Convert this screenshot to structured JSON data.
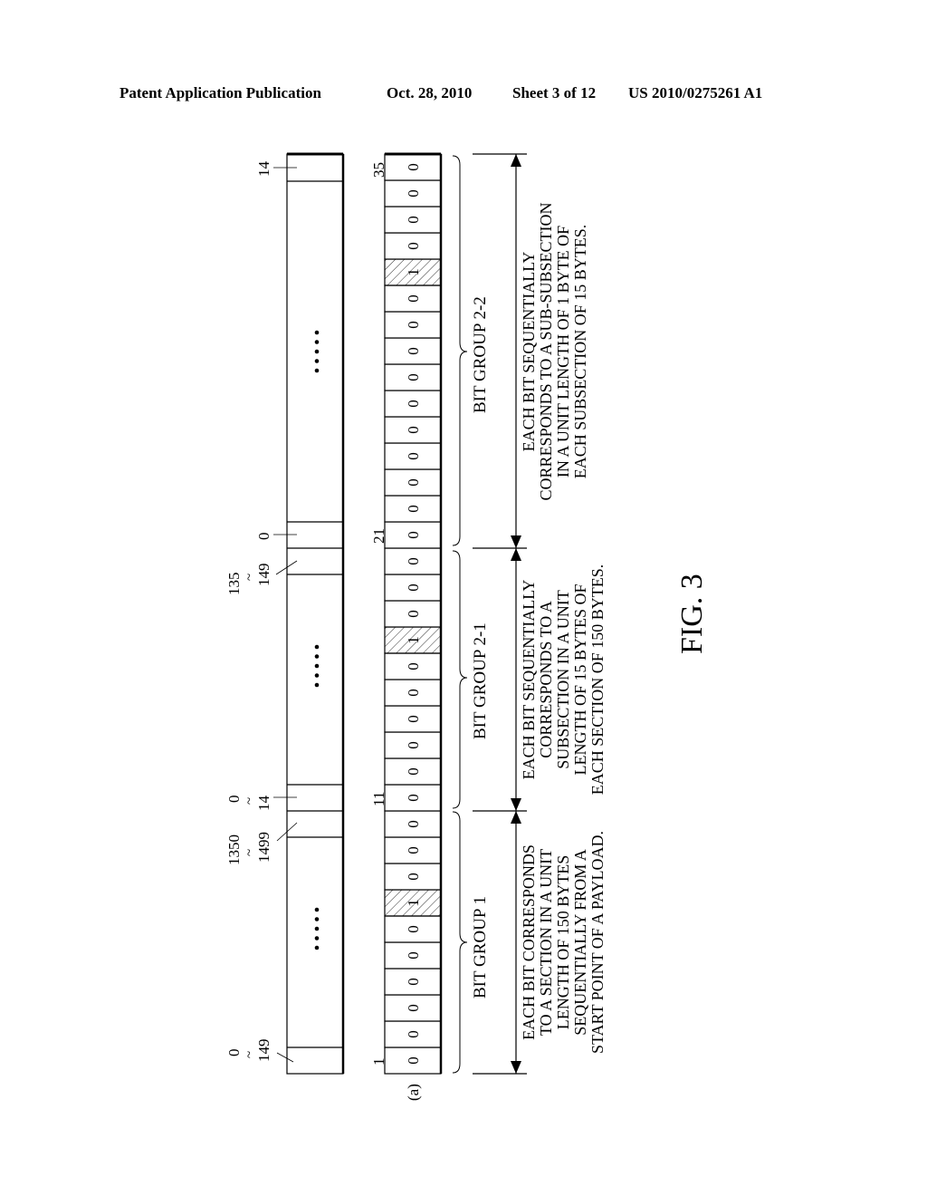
{
  "header": {
    "publication": "Patent Application Publication",
    "date": "Oct. 28, 2010",
    "sheet": "Sheet 3 of 12",
    "number": "US 2010/0275261 A1"
  },
  "figure": {
    "label": "FIG. 3",
    "part_label": "(a)",
    "ellipsis": "•••••",
    "payload_labels": [
      {
        "id": "p1",
        "text_top": "0",
        "tilde": "~",
        "text_bottom": "149"
      },
      {
        "id": "p2",
        "text_top": "1350",
        "tilde": "~",
        "text_bottom": "1499"
      },
      {
        "id": "p3",
        "text_top": "0",
        "tilde": "~",
        "text_bottom": "14"
      },
      {
        "id": "p4",
        "text_top": "135",
        "tilde": "~",
        "text_bottom": "149"
      },
      {
        "id": "p5",
        "text_top": "0",
        "tilde": "",
        "text_bottom": ""
      },
      {
        "id": "p6",
        "text_top": "14",
        "tilde": "",
        "text_bottom": ""
      }
    ],
    "bit_index_labels": [
      "1",
      "11",
      "21",
      "35"
    ],
    "bits": [
      0,
      0,
      0,
      0,
      0,
      0,
      1,
      0,
      0,
      0,
      0,
      0,
      0,
      0,
      0,
      0,
      1,
      0,
      0,
      0,
      0,
      0,
      0,
      0,
      0,
      0,
      0,
      0,
      0,
      0,
      1,
      0,
      0,
      0,
      0
    ],
    "groups": [
      {
        "name": "BIT GROUP 1",
        "description": [
          "EACH BIT CORRESPONDS",
          "TO A SECTION IN A UNIT",
          "LENGTH OF 150 BYTES",
          "SEQUENTIALLY FROM A",
          "START POINT OF A PAYLOAD."
        ]
      },
      {
        "name": "BIT GROUP 2-1",
        "description": [
          "EACH BIT SEQUENTIALLY",
          "CORRESPONDS TO A",
          "SUBSECTION IN A UNIT",
          "LENGTH OF 15 BYTES OF",
          "EACH SECTION OF 150 BYTES."
        ]
      },
      {
        "name": "BIT GROUP 2-2",
        "description": [
          "EACH BIT SEQUENTIALLY",
          "CORRESPONDS TO A SUB-SUBSECTION",
          "IN A UNIT LENGTH OF 1 BYTE OF",
          "EACH SUBSECTION OF 15 BYTES."
        ]
      }
    ]
  }
}
